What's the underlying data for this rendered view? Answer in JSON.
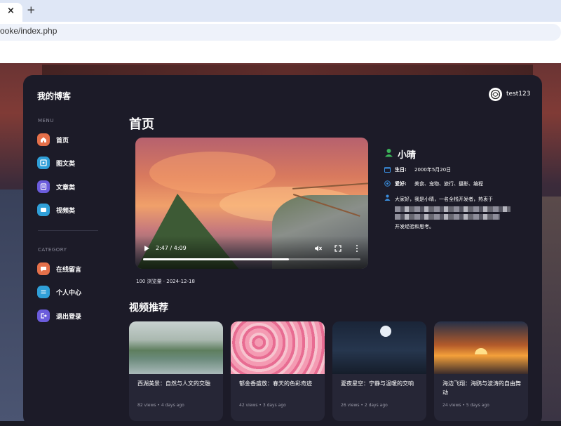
{
  "browser": {
    "tab_close": "×",
    "new_tab": "+",
    "url": "ooke/index.php"
  },
  "app": {
    "brand": "我的博客",
    "username": "test123"
  },
  "menu": {
    "section_label": "MENU",
    "items": [
      {
        "label": "首页",
        "icon": "home-icon",
        "color": "#e5704a"
      },
      {
        "label": "图文类",
        "icon": "image-icon",
        "color": "#2f9fd8"
      },
      {
        "label": "文章类",
        "icon": "article-icon",
        "color": "#6b5cdc"
      },
      {
        "label": "视频类",
        "icon": "video-icon",
        "color": "#2f9fd8"
      }
    ]
  },
  "category": {
    "section_label": "CATEGORY",
    "items": [
      {
        "label": "在线留言",
        "icon": "message-icon",
        "color": "#e5704a"
      },
      {
        "label": "个人中心",
        "icon": "profile-icon",
        "color": "#2f9fd8"
      },
      {
        "label": "退出登录",
        "icon": "logout-icon",
        "color": "#6b5cdc"
      }
    ]
  },
  "page": {
    "title": "首页"
  },
  "video": {
    "time": "2:47 / 4:09",
    "progress": 0.67,
    "meta": "100 浏览量 · 2024-12-18"
  },
  "profile": {
    "name": "小晴",
    "birthday_label": "生日:",
    "birthday": "2000年5月20日",
    "hobby_label": "爱好:",
    "hobbies": "美食、宠物、旅行、摄影、编程",
    "bio_start": "大家好，我是小晴，一名全栈开发者，热衷于",
    "bio_end": "开发经验和思考。"
  },
  "recommend": {
    "title": "视频推荐",
    "cards": [
      {
        "title": "西湖美景：自然与人文的交融",
        "views": "82 views",
        "date": "4 days ago"
      },
      {
        "title": "郁金香盛放：春天的色彩奇迹",
        "views": "42 views",
        "date": "3 days ago"
      },
      {
        "title": "夏夜星空：宁静与温暖的交响",
        "views": "26 views",
        "date": "2 days ago"
      },
      {
        "title": "海边飞翔：海鸥与波涛的自由舞动",
        "views": "24 views",
        "date": "5 days ago"
      }
    ]
  }
}
